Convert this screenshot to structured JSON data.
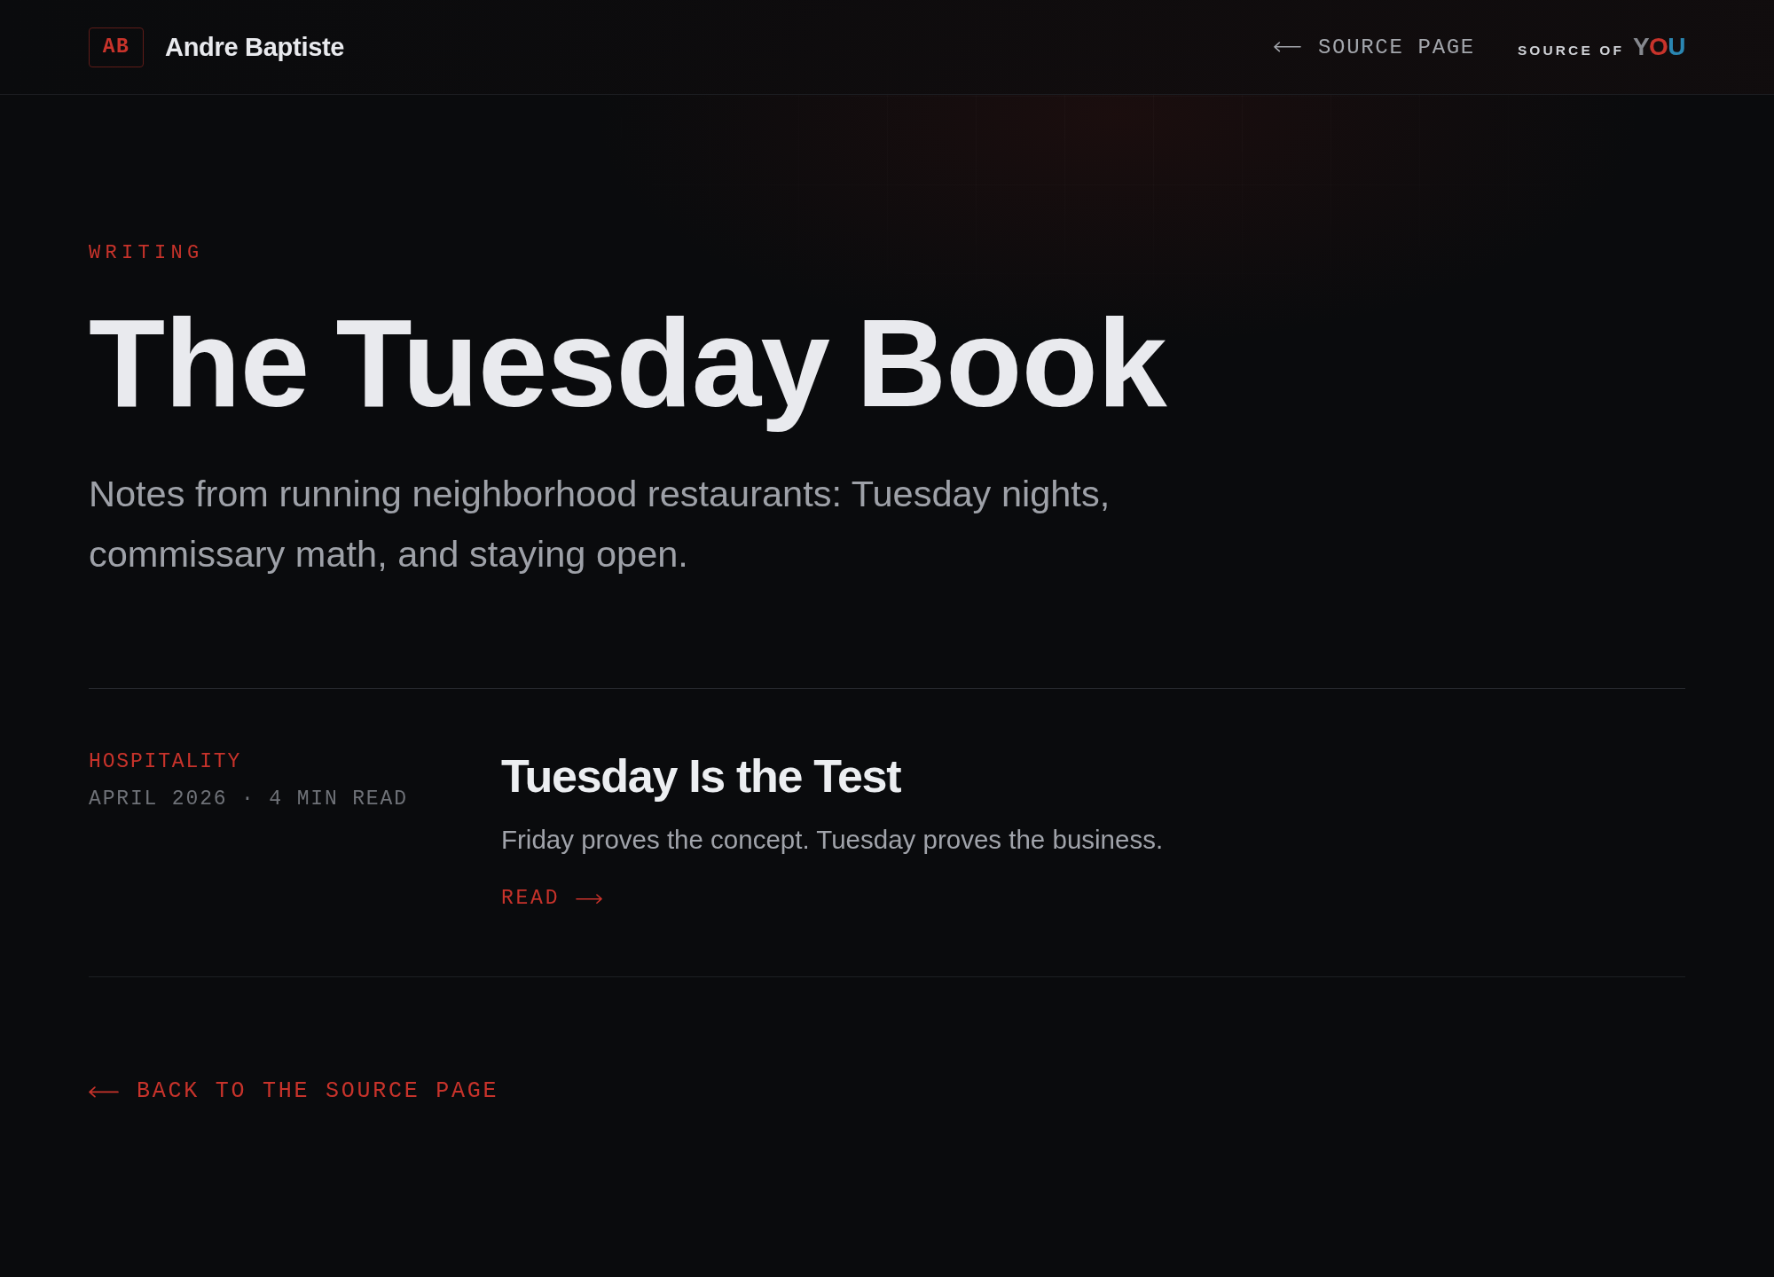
{
  "header": {
    "monogram": "AB",
    "name": "Andre Baptiste",
    "nav_link": "SOURCE PAGE",
    "brand": {
      "prefix": "SOURCE OF",
      "mark": "YOU"
    }
  },
  "hero": {
    "eyebrow": "WRITING",
    "title": "The Tuesday Book",
    "subtitle": "Notes from running neighborhood restaurants: Tuesday nights, commissary math, and staying open."
  },
  "posts": [
    {
      "category": "HOSPITALITY",
      "meta": "APRIL 2026 · 4 MIN READ",
      "title": "Tuesday Is the Test",
      "excerpt": "Friday proves the concept. Tuesday proves the business.",
      "link": "READ"
    }
  ],
  "back_link": "BACK TO THE SOURCE PAGE"
}
